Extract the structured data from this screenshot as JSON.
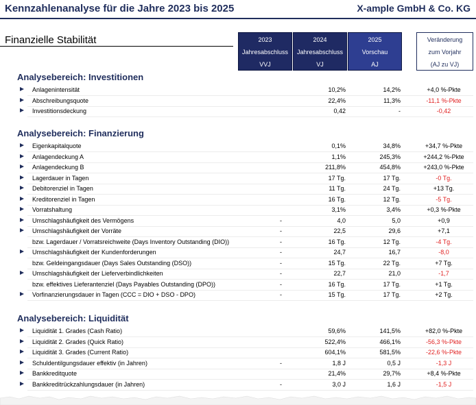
{
  "header": {
    "title": "Kennzahlenanalyse für die Jahre 2023 bis 2025",
    "company": "X-ample GmbH & Co. KG"
  },
  "main_section": "Finanzielle Stabilität",
  "columns": [
    {
      "year": "2023",
      "type": "Jahresabschluss",
      "code": "VVJ"
    },
    {
      "year": "2024",
      "type": "Jahresabschluss",
      "code": "VJ"
    },
    {
      "year": "2025",
      "type": "Vorschau",
      "code": "AJ"
    }
  ],
  "change_header": {
    "line1": "Veränderung",
    "line2": "zum Vorjahr",
    "line3": "(AJ zu VJ)"
  },
  "sections": [
    {
      "title": "Analysebereich: Investitionen",
      "rows": [
        {
          "arrow": true,
          "label": "Anlagenintensität",
          "dash": "",
          "vj": "10,2%",
          "aj": "14,2%",
          "change": "+4,0 %-Pkte",
          "negative": false
        },
        {
          "arrow": true,
          "label": "Abschreibungsquote",
          "dash": "",
          "vj": "22,4%",
          "aj": "11,3%",
          "change": "-11,1 %-Pkte",
          "negative": true
        },
        {
          "arrow": true,
          "label": "Investitionsdeckung",
          "dash": "",
          "vj": "0,42",
          "aj": "-",
          "change": "-0,42",
          "negative": true
        }
      ]
    },
    {
      "title": "Analysebereich: Finanzierung",
      "rows": [
        {
          "arrow": true,
          "label": "Eigenkapitalquote",
          "dash": "",
          "vj": "0,1%",
          "aj": "34,8%",
          "change": "+34,7 %-Pkte",
          "negative": false
        },
        {
          "arrow": true,
          "label": "Anlagendeckung A",
          "dash": "",
          "vj": "1,1%",
          "aj": "245,3%",
          "change": "+244,2 %-Pkte",
          "negative": false
        },
        {
          "arrow": true,
          "label": "Anlagendeckung B",
          "dash": "",
          "vj": "211,8%",
          "aj": "454,8%",
          "change": "+243,0 %-Pkte",
          "negative": false
        },
        {
          "arrow": true,
          "label": "Lagerdauer in Tagen",
          "dash": "",
          "vj": "17 Tg.",
          "aj": "17 Tg.",
          "change": "-0 Tg.",
          "negative": true
        },
        {
          "arrow": true,
          "label": "Debitorenziel in Tagen",
          "dash": "",
          "vj": "11 Tg.",
          "aj": "24 Tg.",
          "change": "+13 Tg.",
          "negative": false
        },
        {
          "arrow": true,
          "label": "Kreditorenziel in Tagen",
          "dash": "",
          "vj": "16 Tg.",
          "aj": "12 Tg.",
          "change": "-5 Tg.",
          "negative": true
        },
        {
          "arrow": true,
          "label": "Vorratshaltung",
          "dash": "",
          "vj": "3,1%",
          "aj": "3,4%",
          "change": "+0,3 %-Pkte",
          "negative": false
        },
        {
          "arrow": true,
          "label": "Umschlagshäufigkeit des Vermögens",
          "dash": "-",
          "vj": "4,0",
          "aj": "5,0",
          "change": "+0,9",
          "negative": false
        },
        {
          "arrow": true,
          "label": "Umschlagshäufigkeit der Vorräte",
          "dash": "-",
          "vj": "22,5",
          "aj": "29,6",
          "change": "+7,1",
          "negative": false
        },
        {
          "arrow": false,
          "label": "bzw. Lagerdauer / Vorratsreichweite (Days Inventory Outstanding (DIO))",
          "dash": "-",
          "vj": "16 Tg.",
          "aj": "12 Tg.",
          "change": "-4 Tg.",
          "negative": true
        },
        {
          "arrow": true,
          "label": "Umschlagshäufigkeit der Kundenforderungen",
          "dash": "-",
          "vj": "24,7",
          "aj": "16,7",
          "change": "-8,0",
          "negative": true
        },
        {
          "arrow": false,
          "label": "bzw. Geldeingangsdauer (Days Sales Outstanding (DSO))",
          "dash": "-",
          "vj": "15 Tg.",
          "aj": "22 Tg.",
          "change": "+7 Tg.",
          "negative": false
        },
        {
          "arrow": true,
          "label": "Umschlagshäufigkeit der Lieferverbindlichkeiten",
          "dash": "-",
          "vj": "22,7",
          "aj": "21,0",
          "change": "-1,7",
          "negative": true
        },
        {
          "arrow": false,
          "label": "bzw. effektives Lieferantenziel (Days Payables Outstanding (DPO))",
          "dash": "-",
          "vj": "16 Tg.",
          "aj": "17 Tg.",
          "change": "+1 Tg.",
          "negative": false
        },
        {
          "arrow": true,
          "label": "Vorfinanzierungsdauer in Tagen (CCC = DIO + DSO - DPO)",
          "dash": "-",
          "vj": "15 Tg.",
          "aj": "17 Tg.",
          "change": "+2 Tg.",
          "negative": false
        }
      ]
    },
    {
      "title": "Analysebereich: Liquidität",
      "rows": [
        {
          "arrow": true,
          "label": "Liquidität 1. Grades (Cash Ratio)",
          "dash": "",
          "vj": "59,6%",
          "aj": "141,5%",
          "change": "+82,0 %-Pkte",
          "negative": false
        },
        {
          "arrow": true,
          "label": "Liquidität 2. Grades (Quick Ratio)",
          "dash": "",
          "vj": "522,4%",
          "aj": "466,1%",
          "change": "-56,3 %-Pkte",
          "negative": true
        },
        {
          "arrow": true,
          "label": "Liquidität 3. Grades (Current Ratio)",
          "dash": "",
          "vj": "604,1%",
          "aj": "581,5%",
          "change": "-22,6 %-Pkte",
          "negative": true
        },
        {
          "arrow": true,
          "label": "Schuldentilgungsdauer effektiv (in Jahren)",
          "dash": "-",
          "vj": "1,8 J",
          "aj": "0,5 J",
          "change": "-1,3 J",
          "negative": true
        },
        {
          "arrow": true,
          "label": "Bankkreditquote",
          "dash": "",
          "vj": "21,4%",
          "aj": "29,7%",
          "change": "+8,4 %-Pkte",
          "negative": false
        },
        {
          "arrow": true,
          "label": "Bankkreditrückzahlungsdauer (in Jahren)",
          "dash": "-",
          "vj": "3,0 J",
          "aj": "1,6 J",
          "change": "-1,5 J",
          "negative": true
        }
      ]
    }
  ]
}
